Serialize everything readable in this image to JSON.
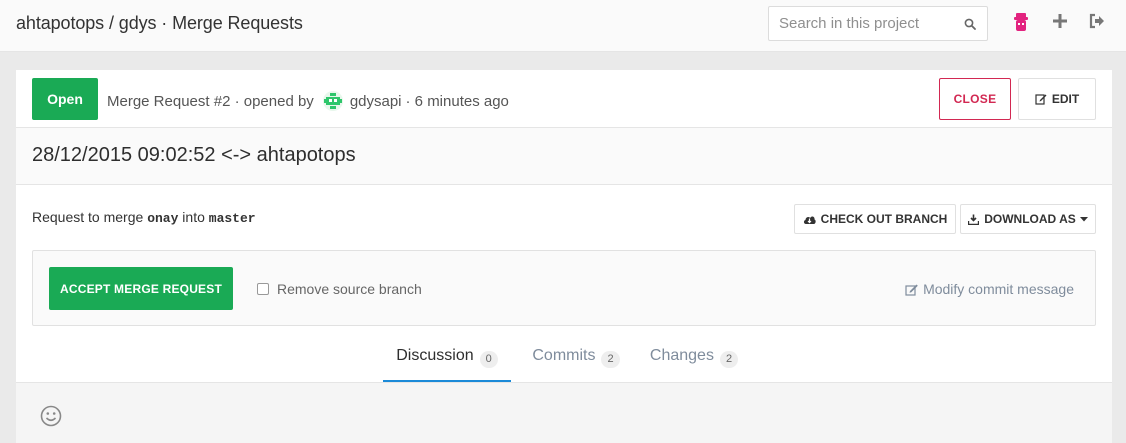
{
  "header": {
    "title": "ahtapotops / gdys · Merge Requests",
    "search_placeholder": "Search in this project",
    "icons": [
      "search-icon",
      "user-avatar-icon",
      "plus-icon",
      "sign-out-icon"
    ]
  },
  "merge_request": {
    "status": "Open",
    "meta_prefix": "Merge Request #2 · opened by",
    "author": "gdysapi",
    "meta_suffix": "· 6 minutes ago",
    "close_label": "CLOSE",
    "edit_label": "EDIT",
    "title": "28/12/2015 09:02:52 <-> ahtapotops",
    "request_prefix": "Request to merge",
    "source_branch": "onay",
    "request_into": "into",
    "target_branch": "master",
    "checkout_label": "CHECK OUT BRANCH",
    "download_label": "DOWNLOAD AS",
    "accept_label": "ACCEPT MERGE REQUEST",
    "remove_source_label": "Remove source branch",
    "modify_commit_label": "Modify commit message"
  },
  "tabs": [
    {
      "label": "Discussion",
      "count": "0",
      "active": true
    },
    {
      "label": "Commits",
      "count": "2",
      "active": false
    },
    {
      "label": "Changes",
      "count": "2",
      "active": false
    }
  ],
  "colors": {
    "accent_green": "#1aaa55",
    "close_red": "#d22852",
    "tab_active_border": "#1b8ad8",
    "user_icon_pink": "#e2237f"
  }
}
